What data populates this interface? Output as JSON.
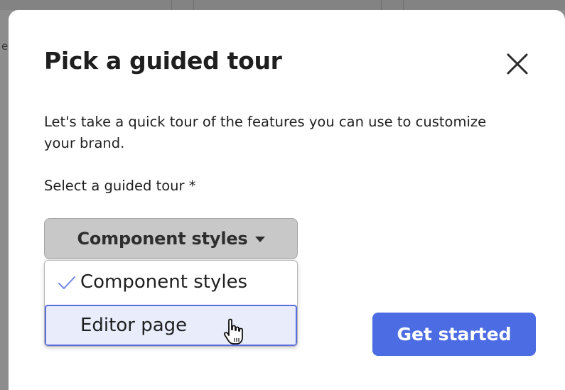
{
  "background": {
    "partial_letter": "e"
  },
  "modal": {
    "title": "Pick a guided tour",
    "description": "Let's take a quick tour of the features you can use to customize your brand.",
    "field_label": "Select a guided tour *",
    "close_icon": "close-icon",
    "select": {
      "selected_value": "Component styles",
      "options": [
        {
          "label": "Component styles",
          "checked": true,
          "hovered": false
        },
        {
          "label": "Editor page",
          "checked": false,
          "hovered": true
        }
      ]
    },
    "primary_button_label": "Get started"
  },
  "colors": {
    "accent": "#4c6ce3",
    "hover_bg": "#e8ecfb",
    "hover_border": "#5b6ee0",
    "check": "#6f86e6",
    "trigger_bg": "#c8c8c8"
  }
}
